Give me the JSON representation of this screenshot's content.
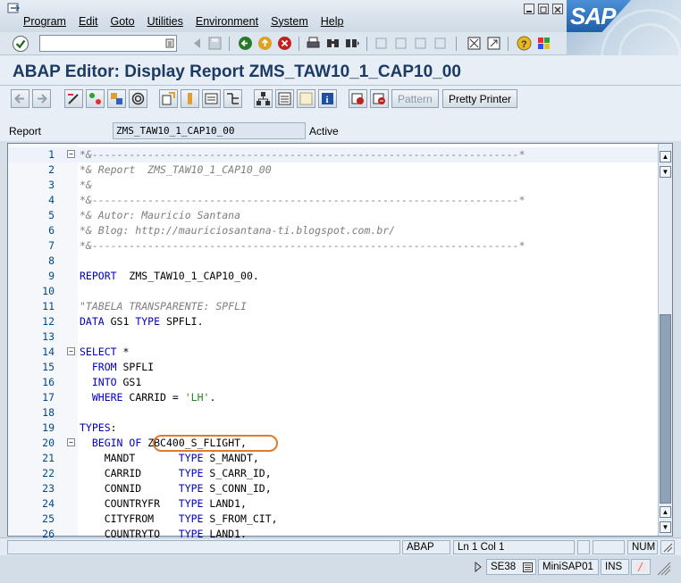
{
  "menu": {
    "items": [
      "Program",
      "Edit",
      "Goto",
      "Utilities",
      "Environment",
      "System",
      "Help"
    ]
  },
  "brand": {
    "logo": "SAP"
  },
  "title": "ABAP Editor: Display Report ZMS_TAW10_1_CAP10_00",
  "app_toolbar": {
    "pattern_label": "Pattern",
    "pretty_printer_label": "Pretty Printer"
  },
  "report": {
    "label": "Report",
    "value": "ZMS_TAW10_1_CAP10_00",
    "status": "Active"
  },
  "code": [
    {
      "n": "1",
      "text": "*&---------------------------------------------------------------------*"
    },
    {
      "n": "2",
      "text": "*& Report  ZMS_TAW10_1_CAP10_00"
    },
    {
      "n": "3",
      "text": "*&"
    },
    {
      "n": "4",
      "text": "*&---------------------------------------------------------------------*"
    },
    {
      "n": "5",
      "text": "*& Autor: Mauricio Santana"
    },
    {
      "n": "6",
      "text": "*& Blog: http://mauriciosantana-ti.blogspot.com.br/"
    },
    {
      "n": "7",
      "text": "*&---------------------------------------------------------------------*"
    },
    {
      "n": "8",
      "text": ""
    },
    {
      "n": "9",
      "text": "REPORT  ZMS_TAW10_1_CAP10_00."
    },
    {
      "n": "10",
      "text": ""
    },
    {
      "n": "11",
      "text": "\"TABELA TRANSPARENTE: SPFLI"
    },
    {
      "n": "12",
      "text": "DATA GS1 TYPE SPFLI."
    },
    {
      "n": "13",
      "text": ""
    },
    {
      "n": "14",
      "text": "SELECT *"
    },
    {
      "n": "15",
      "text": "  FROM SPFLI"
    },
    {
      "n": "16",
      "text": "  INTO GS1"
    },
    {
      "n": "17",
      "text": "  WHERE CARRID = 'LH'."
    },
    {
      "n": "18",
      "text": ""
    },
    {
      "n": "19",
      "text": "TYPES:"
    },
    {
      "n": "20",
      "text": "  BEGIN OF ZBC400_S_FLIGHT,"
    },
    {
      "n": "21",
      "text": "    MANDT       TYPE S_MANDT,"
    },
    {
      "n": "22",
      "text": "    CARRID      TYPE S_CARR_ID,"
    },
    {
      "n": "23",
      "text": "    CONNID      TYPE S_CONN_ID,"
    },
    {
      "n": "24",
      "text": "    COUNTRYFR   TYPE LAND1,"
    },
    {
      "n": "25",
      "text": "    CITYFROM    TYPE S_FROM_CIT,"
    },
    {
      "n": "26",
      "text": "    COUNTRYTO   TYPE LAND1,"
    }
  ],
  "status": {
    "lang": "ABAP",
    "position": "Ln  1 Col  1",
    "num": "NUM",
    "transaction": "SE38",
    "server": "MiniSAP01",
    "mode": "INS"
  }
}
